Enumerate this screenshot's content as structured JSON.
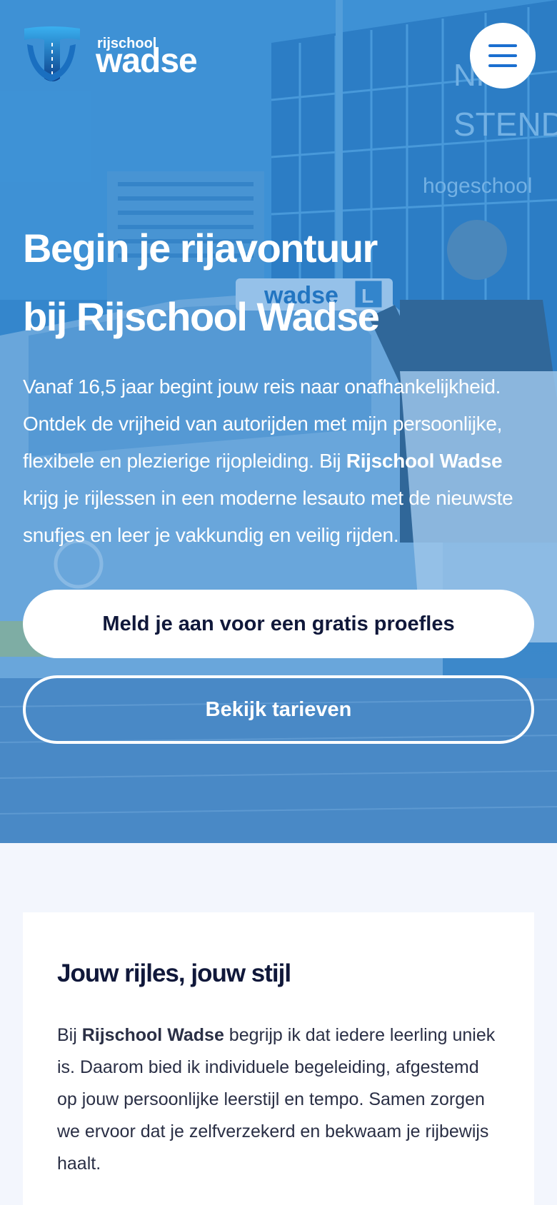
{
  "brand": {
    "small": "rijschool",
    "big": "wadse"
  },
  "hero": {
    "headline_line1": "Begin je rijavontuur",
    "headline_line2": "bij Rijschool Wadse",
    "intro_part1": "Vanaf 16,5 jaar begint jouw reis naar onafhankelijkheid. Ontdek de vrijheid van autorijden met mijn persoonlijke, flexibele en plezierige rijopleiding. Bij ",
    "intro_bold": "Rijschool Wadse",
    "intro_part2": " krijg je rijlessen in een moderne lesauto met de nieuwste snufjes en leer je vakkundig en veilig rijden.",
    "cta_primary": "Meld je aan voor een gratis proefles",
    "cta_secondary": "Bekijk tarieven"
  },
  "section": {
    "title": "Jouw rijles, jouw stijl",
    "text_part1": "Bij ",
    "text_bold": "Rijschool Wadse",
    "text_part2": " begrijp ik dat iedere leerling uniek is. Daarom bied ik individuele begeleiding, afgestemd op jouw persoonlijke leerstijl en tempo. Samen zorgen we ervoor dat je zelfverzekerd en bekwaam je rijbewijs haalt."
  },
  "photo_signage": {
    "building_1": "NHL",
    "building_2": "STEND",
    "building_3": "hogeschool",
    "car_brand": "wadse",
    "car_l_sign": "L"
  },
  "colors": {
    "hero_blue": "#3a88c9",
    "accent_blue": "#1b6fd0",
    "dark_text": "#10183a",
    "page_bg": "#f3f6fd"
  },
  "icons": {
    "menu": "hamburger-icon",
    "logo": "wadse-t-logo"
  }
}
